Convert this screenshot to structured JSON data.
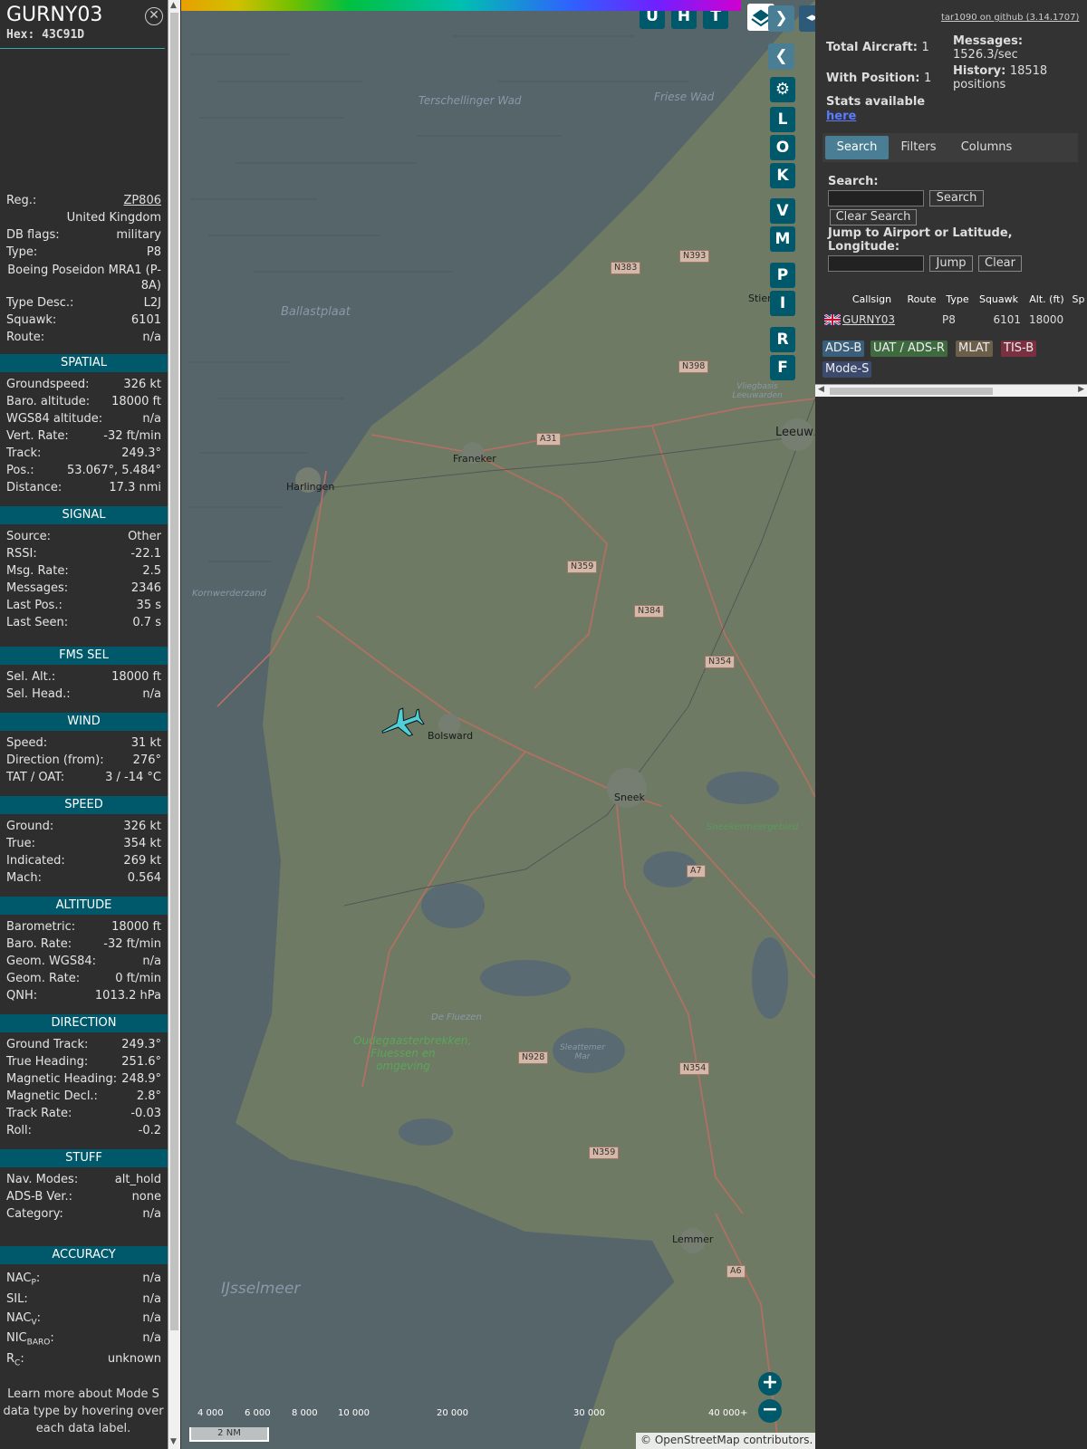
{
  "aircraft": {
    "callsign": "GURNY03",
    "hex_label": "Hex:",
    "hex": "43C91D",
    "registration": "ZP806",
    "country": "United Kingdom",
    "db_flags": "military",
    "type": "P8",
    "type_name": "Boeing Poseidon MRA1 (P-8A)",
    "type_desc": "L2J",
    "squawk": "6101",
    "route": "n/a"
  },
  "labels": {
    "reg": "Reg.:",
    "db_flags": "DB flags:",
    "type": "Type:",
    "type_desc": "Type Desc.:",
    "squawk": "Squawk:",
    "route": "Route:"
  },
  "sections": {
    "spatial": "SPATIAL",
    "signal": "SIGNAL",
    "fms_sel": "FMS SEL",
    "wind": "WIND",
    "speed": "SPEED",
    "altitude": "ALTITUDE",
    "direction": "DIRECTION",
    "stuff": "STUFF",
    "accuracy": "ACCURACY"
  },
  "spatial": [
    {
      "label": "Groundspeed:",
      "value": "326 kt"
    },
    {
      "label": "Baro. altitude:",
      "value": "18000 ft"
    },
    {
      "label": "WGS84 altitude:",
      "value": "n/a"
    },
    {
      "label": "Vert. Rate:",
      "value": "-32 ft/min"
    },
    {
      "label": "Track:",
      "value": "249.3°"
    },
    {
      "label": "Pos.:",
      "value": "53.067°, 5.484°"
    },
    {
      "label": "Distance:",
      "value": "17.3 nmi"
    }
  ],
  "signal": [
    {
      "label": "Source:",
      "value": "Other"
    },
    {
      "label": "RSSI:",
      "value": "-22.1"
    },
    {
      "label": "Msg. Rate:",
      "value": "2.5"
    },
    {
      "label": "Messages:",
      "value": "2346"
    },
    {
      "label": "Last Pos.:",
      "value": "35 s"
    },
    {
      "label": "Last Seen:",
      "value": "0.7 s"
    }
  ],
  "fms": [
    {
      "label": "Sel. Alt.:",
      "value": "18000 ft"
    },
    {
      "label": "Sel. Head.:",
      "value": "n/a"
    }
  ],
  "wind": [
    {
      "label": "Speed:",
      "value": "31 kt"
    },
    {
      "label": "Direction (from):",
      "value": "276°"
    },
    {
      "label": "TAT / OAT:",
      "value": "3 / -14 °C"
    }
  ],
  "speed": [
    {
      "label": "Ground:",
      "value": "326 kt"
    },
    {
      "label": "True:",
      "value": "354 kt"
    },
    {
      "label": "Indicated:",
      "value": "269 kt"
    },
    {
      "label": "Mach:",
      "value": "0.564"
    }
  ],
  "altitude": [
    {
      "label": "Barometric:",
      "value": "18000 ft"
    },
    {
      "label": "Baro. Rate:",
      "value": "-32 ft/min"
    },
    {
      "label": "Geom. WGS84:",
      "value": "n/a"
    },
    {
      "label": "Geom. Rate:",
      "value": "0 ft/min"
    },
    {
      "label": "QNH:",
      "value": "1013.2 hPa"
    }
  ],
  "direction": [
    {
      "label": "Ground Track:",
      "value": "249.3°"
    },
    {
      "label": "True Heading:",
      "value": "251.6°"
    },
    {
      "label": "Magnetic Heading:",
      "value": "248.9°"
    },
    {
      "label": "Magnetic Decl.:",
      "value": "2.8°"
    },
    {
      "label": "Track Rate:",
      "value": "-0.03"
    },
    {
      "label": "Roll:",
      "value": "-0.2"
    }
  ],
  "stuff": [
    {
      "label": "Nav. Modes:",
      "value": "alt_hold"
    },
    {
      "label": "ADS-B Ver.:",
      "value": "none"
    },
    {
      "label": "Category:",
      "value": "n/a"
    }
  ],
  "accuracy": {
    "nacp_label": "NAC",
    "nacp_sub": "P",
    "nacp": "n/a",
    "sil_label": "SIL:",
    "sil": "n/a",
    "nacv_label": "NAC",
    "nacv_sub": "V",
    "nacv": "n/a",
    "nicbaro_label": "NIC",
    "nicbaro_sub": "BARO",
    "nicbaro": "n/a",
    "rc_label": "R",
    "rc_sub": "C",
    "rc": "unknown"
  },
  "footnote": "Learn more about Mode S data type by hovering over each data label.",
  "map": {
    "buttons_top": [
      "U",
      "H",
      "T"
    ],
    "buttons_side": [
      "L",
      "O",
      "K",
      "V",
      "M",
      "P",
      "I",
      "R",
      "F"
    ],
    "altitude_scale": [
      "4 000",
      "6 000",
      "8 000",
      "10 000",
      "20 000",
      "30 000",
      "40 000+"
    ],
    "scale_label": "2 NM",
    "attribution_prefix": "© ",
    "attribution_link": "OpenStreetMap",
    "attribution_suffix": " contributors.",
    "places": {
      "terschelling": "Terschellinger Wad",
      "friese": "Friese Wad",
      "ballast": "Ballastplaat",
      "kornwerderzand": "Kornwerderzand",
      "franeker": "Franeker",
      "harlingen": "Harlingen",
      "bolsward": "Bolsward",
      "sneek": "Sneek",
      "leeuw": "Leeuw",
      "stien": "Stien",
      "vliegbasis": "Vliegbasis Leeuwarden",
      "sneekermeer": "Sneekermeergebied",
      "fluezen": "De Fluezen",
      "oudega": "Oudegaasterbrekken, Fluessen en omgeving",
      "slotermeer": "Sleattemer Mar",
      "lemmer": "Lemmer",
      "ijsselmeer": "IJsselmeer"
    },
    "roads": {
      "n383": "N383",
      "n393": "N393",
      "n398": "N398",
      "a31": "A31",
      "n359a": "N359",
      "n384": "N384",
      "n354a": "N354",
      "a7": "A7",
      "n928": "N928",
      "n354b": "N354",
      "n359b": "N359",
      "a6": "A6"
    }
  },
  "info": {
    "github": "tar1090 on github (3.14.1707)",
    "total_aircraft_label": "Total Aircraft:",
    "total_aircraft": "1",
    "with_position_label": "With Position:",
    "with_position": "1",
    "messages_label": "Messages:",
    "messages": "1526.3/sec",
    "history_label": "History:",
    "history": "18518 positions",
    "stats_label": "Stats available",
    "stats_link": "here",
    "tabs": [
      "Search",
      "Filters",
      "Columns"
    ],
    "search_label": "Search:",
    "search_button": "Search",
    "clear_search_button": "Clear Search",
    "jump_label": "Jump to Airport or Latitude, Longitude:",
    "jump_button": "Jump",
    "clear_button": "Clear",
    "columns": [
      "Callsign",
      "Route",
      "Type",
      "Squawk",
      "Alt. (ft)",
      "Sp"
    ],
    "row": {
      "callsign": "GURNY03",
      "route": "",
      "type": "P8",
      "squawk": "6101",
      "alt": "18000"
    },
    "badges": [
      {
        "label": "ADS-B",
        "color": "#3a5f7a"
      },
      {
        "label": "UAT / ADS-R",
        "color": "#3f6a3f"
      },
      {
        "label": "MLAT",
        "color": "#6b5e4a"
      },
      {
        "label": "TIS-B",
        "color": "#7a3040"
      },
      {
        "label": "Mode-S",
        "color": "#3c4a6e"
      }
    ]
  }
}
